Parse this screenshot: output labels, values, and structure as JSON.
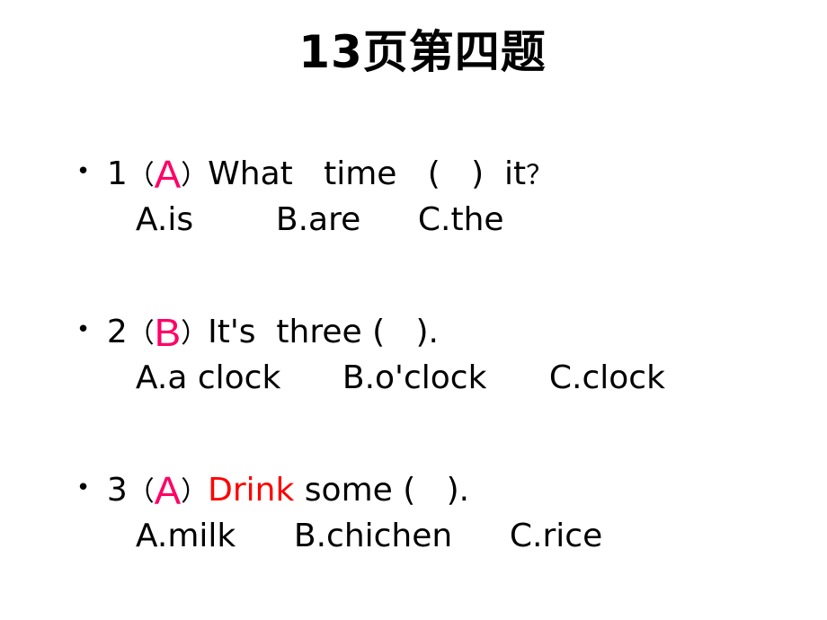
{
  "title": "13页第四题",
  "questions": [
    {
      "number": "1",
      "open_paren": "（",
      "answer": "A",
      "close_paren": "）",
      "prefix_highlight": "",
      "stem": "What   time   (   )  it",
      "end_mark": "？",
      "options": [
        "A.is",
        "B.are",
        "C.the"
      ]
    },
    {
      "number": "2",
      "open_paren": "（",
      "answer": "B",
      "close_paren": "）",
      "prefix_highlight": "",
      "stem": "It's  three (   ).",
      "end_mark": "",
      "options": [
        "A.a clock",
        "B.o'clock",
        "C.clock"
      ]
    },
    {
      "number": "3",
      "open_paren": "（",
      "answer": "A",
      "close_paren": "）",
      "prefix_highlight": "Drink",
      "stem": " some (   ).",
      "end_mark": "",
      "options": [
        "A.milk",
        "B.chichen",
        "C.rice"
      ]
    }
  ],
  "colors": {
    "answer": "#ff0066",
    "highlight": "#ff0000",
    "text": "#000000"
  },
  "bullet": "•"
}
